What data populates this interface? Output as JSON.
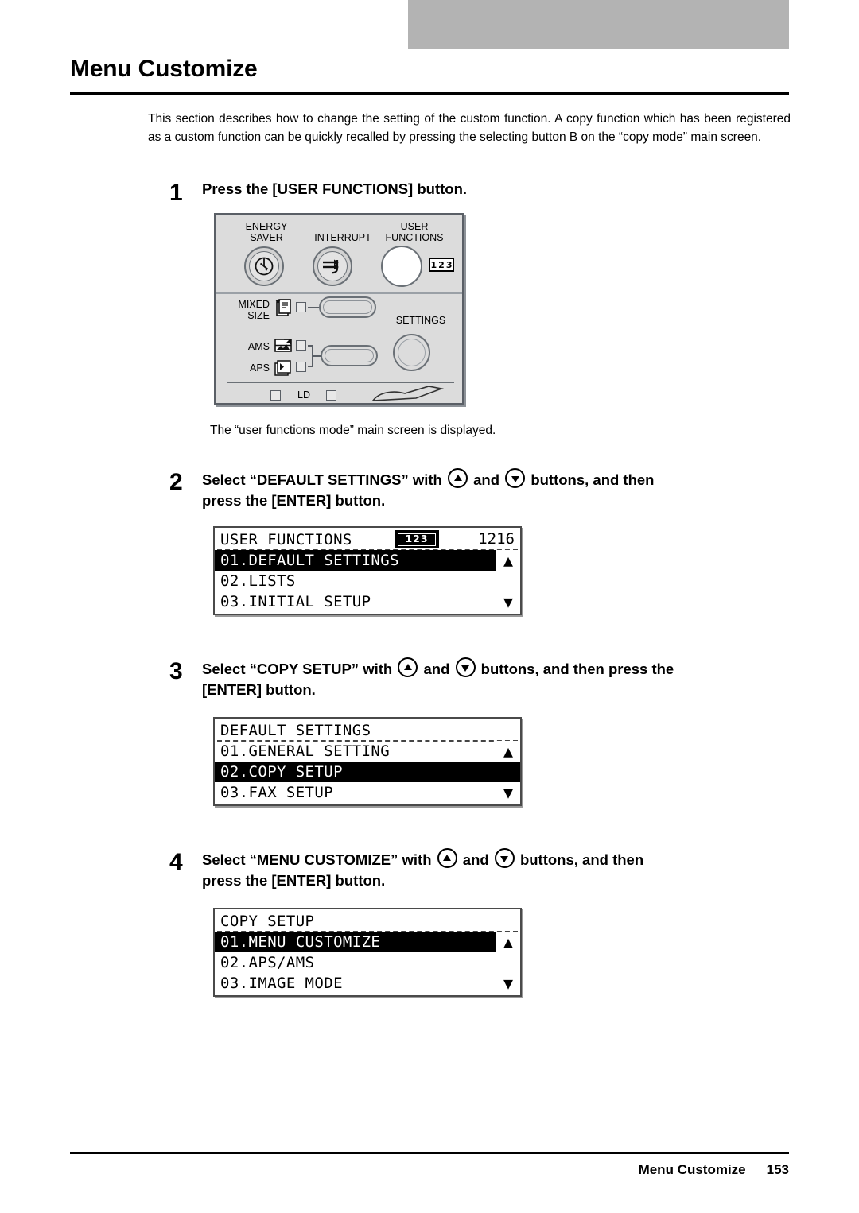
{
  "document": {
    "page_title": "Menu Customize",
    "intro_paragraph": "This section describes how to change the setting of the custom function. A copy function which has been registered as a custom function can be quickly recalled by pressing the selecting button B on the “copy mode” main screen.",
    "footer_section": "Menu Customize",
    "footer_page": "153"
  },
  "steps": [
    {
      "number": "1",
      "text": "Press the [USER FUNCTIONS] button.",
      "caption": "The “user functions mode” main screen is displayed."
    },
    {
      "number": "2",
      "text_part1": "Select “DEFAULT SETTINGS” with",
      "text_mid": "and",
      "text_part2": "buttons, and then",
      "text_line2": "press the [ENTER] button."
    },
    {
      "number": "3",
      "text_part1": "Select “COPY SETUP” with",
      "text_mid": "and",
      "text_part2": "buttons, and then press the",
      "text_line2": "[ENTER] button."
    },
    {
      "number": "4",
      "text_part1": "Select “MENU CUSTOMIZE” with",
      "text_mid": "and",
      "text_part2": "buttons, and then",
      "text_line2": "press the [ENTER] button."
    }
  ],
  "control_panel": {
    "labels": {
      "energy_saver": "ENERGY\nSAVER",
      "interrupt": "INTERRUPT",
      "user_functions": "USER\nFUNCTIONS",
      "mixed_size": "MIXED\nSIZE",
      "ams": "AMS",
      "aps": "APS",
      "settings": "SETTINGS",
      "ld": "LD"
    },
    "badge_digits": [
      "1",
      "2",
      "3"
    ]
  },
  "lcd_screens": [
    {
      "id": "user-functions",
      "title": "USER FUNCTIONS",
      "badge": "123",
      "clock": "1216",
      "rows": [
        {
          "label": "01.DEFAULT SETTINGS",
          "selected": true,
          "arrow": "▲"
        },
        {
          "label": "02.LISTS",
          "selected": false,
          "arrow": ""
        },
        {
          "label": "03.INITIAL SETUP",
          "selected": false,
          "arrow": "▼"
        }
      ]
    },
    {
      "id": "default-settings",
      "title": "DEFAULT SETTINGS",
      "badge": "",
      "clock": "",
      "rows": [
        {
          "label": "01.GENERAL SETTING",
          "selected": false,
          "arrow": "▲"
        },
        {
          "label": "02.COPY SETUP",
          "selected": true,
          "arrow": ""
        },
        {
          "label": "03.FAX SETUP",
          "selected": false,
          "arrow": "▼"
        }
      ]
    },
    {
      "id": "copy-setup",
      "title": "COPY SETUP",
      "badge": "",
      "clock": "",
      "rows": [
        {
          "label": "01.MENU CUSTOMIZE",
          "selected": true,
          "arrow": "▲"
        },
        {
          "label": "02.APS/AMS",
          "selected": false,
          "arrow": ""
        },
        {
          "label": "03.IMAGE MODE",
          "selected": false,
          "arrow": "▼"
        }
      ]
    }
  ],
  "colors": {
    "header_bar": "#b3b3b3",
    "panel_face": "#dcdcdc",
    "panel_edge": "#5a5f66",
    "lcd_selected_bg": "#000000"
  }
}
